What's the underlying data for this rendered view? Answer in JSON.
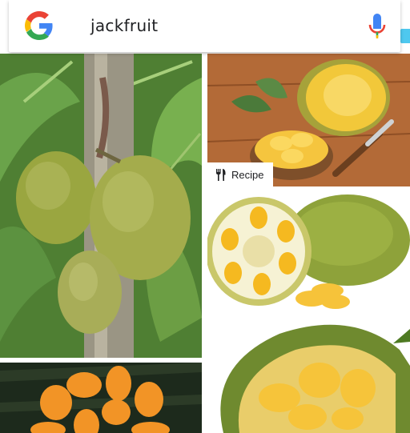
{
  "search": {
    "query": "jackfruit",
    "logo_icon": "google-g-icon",
    "mic_icon": "microphone-icon"
  },
  "results": [
    {
      "name": "image-result-tree",
      "description_icon": "photo"
    },
    {
      "name": "image-result-recipe",
      "badge": {
        "icon": "fork-knife-icon",
        "label": "Recipe"
      }
    },
    {
      "name": "image-result-cut-fruit"
    },
    {
      "name": "image-result-bulbs"
    },
    {
      "name": "image-result-open-fruit"
    }
  ],
  "colors": {
    "google_blue": "#4285F4",
    "google_red": "#EA4335",
    "google_yellow": "#FBBC05",
    "google_green": "#34A853",
    "jackfruit_skin": "#9aa640",
    "jackfruit_flesh": "#f7c62f"
  }
}
